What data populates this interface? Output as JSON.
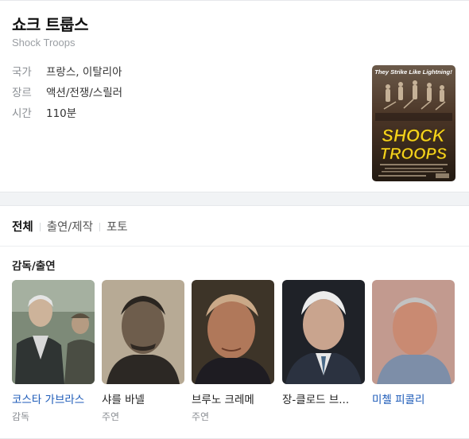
{
  "movie": {
    "title": "쇼크 트룹스",
    "original_title": "Shock Troops",
    "info": [
      {
        "label": "국가",
        "value": "프랑스, 이탈리아"
      },
      {
        "label": "장르",
        "value": "액션/전쟁/스릴러"
      },
      {
        "label": "시간",
        "value": "110분"
      }
    ],
    "poster": {
      "tagline": "They Strike Like Lightning!",
      "title_line1": "SHOCK",
      "title_line2": "TROOPS"
    }
  },
  "tabs": [
    {
      "label": "전체",
      "active": true
    },
    {
      "label": "출연/제작",
      "active": false
    },
    {
      "label": "포토",
      "active": false
    }
  ],
  "cast_section_title": "감독/출연",
  "cast": [
    {
      "name": "코스타 가브라스",
      "role": "감독",
      "link": true
    },
    {
      "name": "샤를 바넬",
      "role": "주연",
      "link": false
    },
    {
      "name": "브루노 크레메",
      "role": "주연",
      "link": false
    },
    {
      "name": "장-클로드 브...",
      "role": "",
      "link": false
    },
    {
      "name": "미첼 피콜리",
      "role": "",
      "link": true
    }
  ],
  "colors": {
    "link": "#1c5ab8",
    "poster_title": "#f4d21c",
    "poster_bg": "#3a2a1c"
  }
}
